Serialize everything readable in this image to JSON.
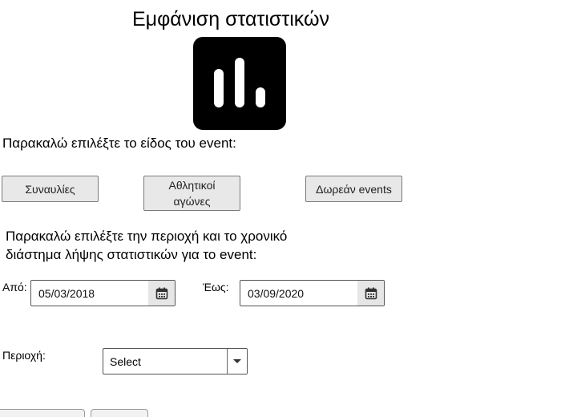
{
  "page": {
    "title": "Εμφάνιση στατιστικών",
    "logo_icon": "bar-chart-icon"
  },
  "event_type": {
    "prompt": "Παρακαλώ επιλέξτε το είδος του event:",
    "buttons": [
      "Συναυλίες",
      "Αθλητικοί αγώνες",
      "Δωρεάν events"
    ]
  },
  "filters": {
    "prompt_line1": "Παρακαλώ επιλέξτε την περιοχή και το χρονικό",
    "prompt_line2": "διάστημα λήψης στατιστικών για το event:",
    "from_label": "Από:",
    "from_value": "05/03/2018",
    "to_label": "Έως:",
    "to_value": "03/09/2020",
    "calendar_icon": "calendar-icon",
    "region_label": "Περιοχή:",
    "region_value": "Select",
    "dropdown_icon": "chevron-down-icon"
  }
}
